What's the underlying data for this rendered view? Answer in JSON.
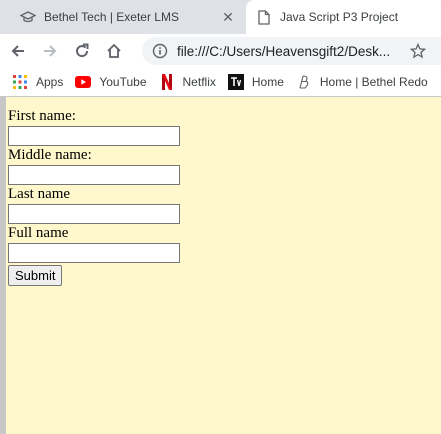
{
  "tabs": [
    {
      "title": "Bethel Tech | Exeter LMS",
      "icon": "graduation-cap-icon",
      "active": false
    },
    {
      "title": "Java Script P3 Project",
      "icon": "document-icon",
      "active": true
    }
  ],
  "toolbar": {
    "url": "file:///C:/Users/Heavensgift2/Desk..."
  },
  "bookmarks": [
    {
      "label": "Apps",
      "icon": "apps-grid-icon"
    },
    {
      "label": "YouTube",
      "icon": "youtube-icon"
    },
    {
      "label": "Netflix",
      "icon": "netflix-icon"
    },
    {
      "label": "Home",
      "icon": "tv-icon"
    },
    {
      "label": "Home | Bethel Redo",
      "icon": "bethel-icon"
    }
  ],
  "form": {
    "first_name_label": "First name:",
    "middle_name_label": "Middle name:",
    "last_name_label": "Last name",
    "full_name_label": "Full name",
    "first_name_value": "",
    "middle_name_value": "",
    "last_name_value": "",
    "full_name_value": "",
    "submit_label": "Submit"
  },
  "colors": {
    "page_background": "#fff8cc",
    "youtube_red": "#ff0000",
    "netflix_red": "#e50914"
  }
}
